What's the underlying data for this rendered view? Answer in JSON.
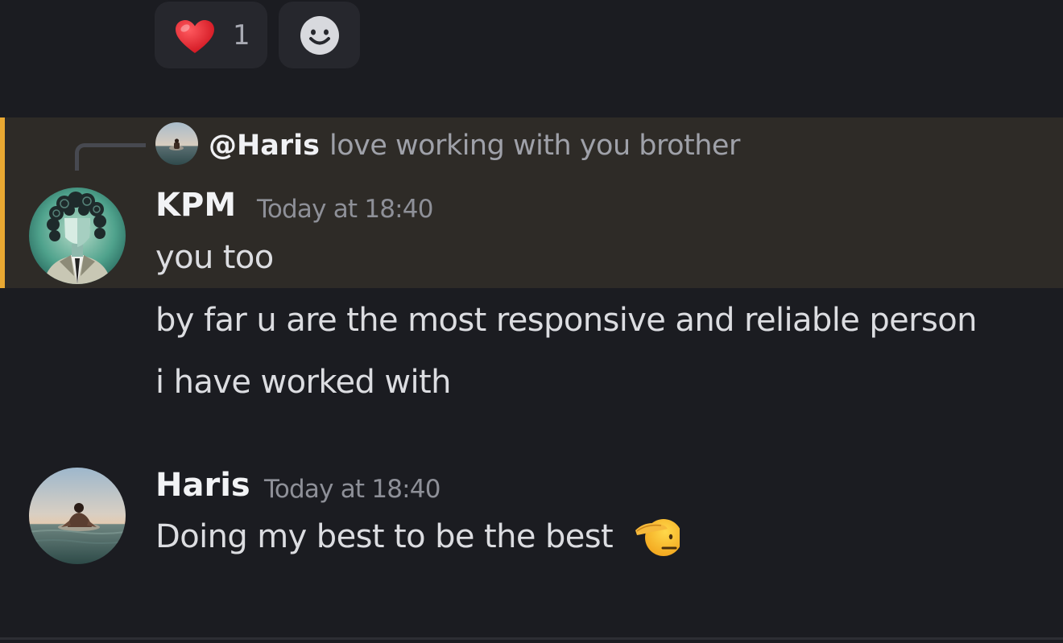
{
  "reactions": {
    "heart": {
      "icon": "heart-icon",
      "count": "1",
      "color": "#e5232d"
    },
    "add_reaction": {
      "icon": "smile-icon"
    }
  },
  "reply_preview": {
    "mention": "@Haris",
    "text": "love working with you brother"
  },
  "messages": [
    {
      "author": "KPM",
      "timestamp": "Today at 18:40",
      "lines": [
        "you too",
        "by far u are the most responsive and reliable person",
        "i have worked with"
      ],
      "highlighted": true,
      "highlight_color": "#e9a832"
    },
    {
      "author": "Haris",
      "timestamp": "Today at 18:40",
      "lines": [
        "Doing my best to be the best"
      ],
      "emoji": "salute-icon"
    }
  ],
  "theme": {
    "background": "#1b1c21",
    "reaction_bg": "#26272d",
    "highlight_bg": "#2e2b27"
  }
}
